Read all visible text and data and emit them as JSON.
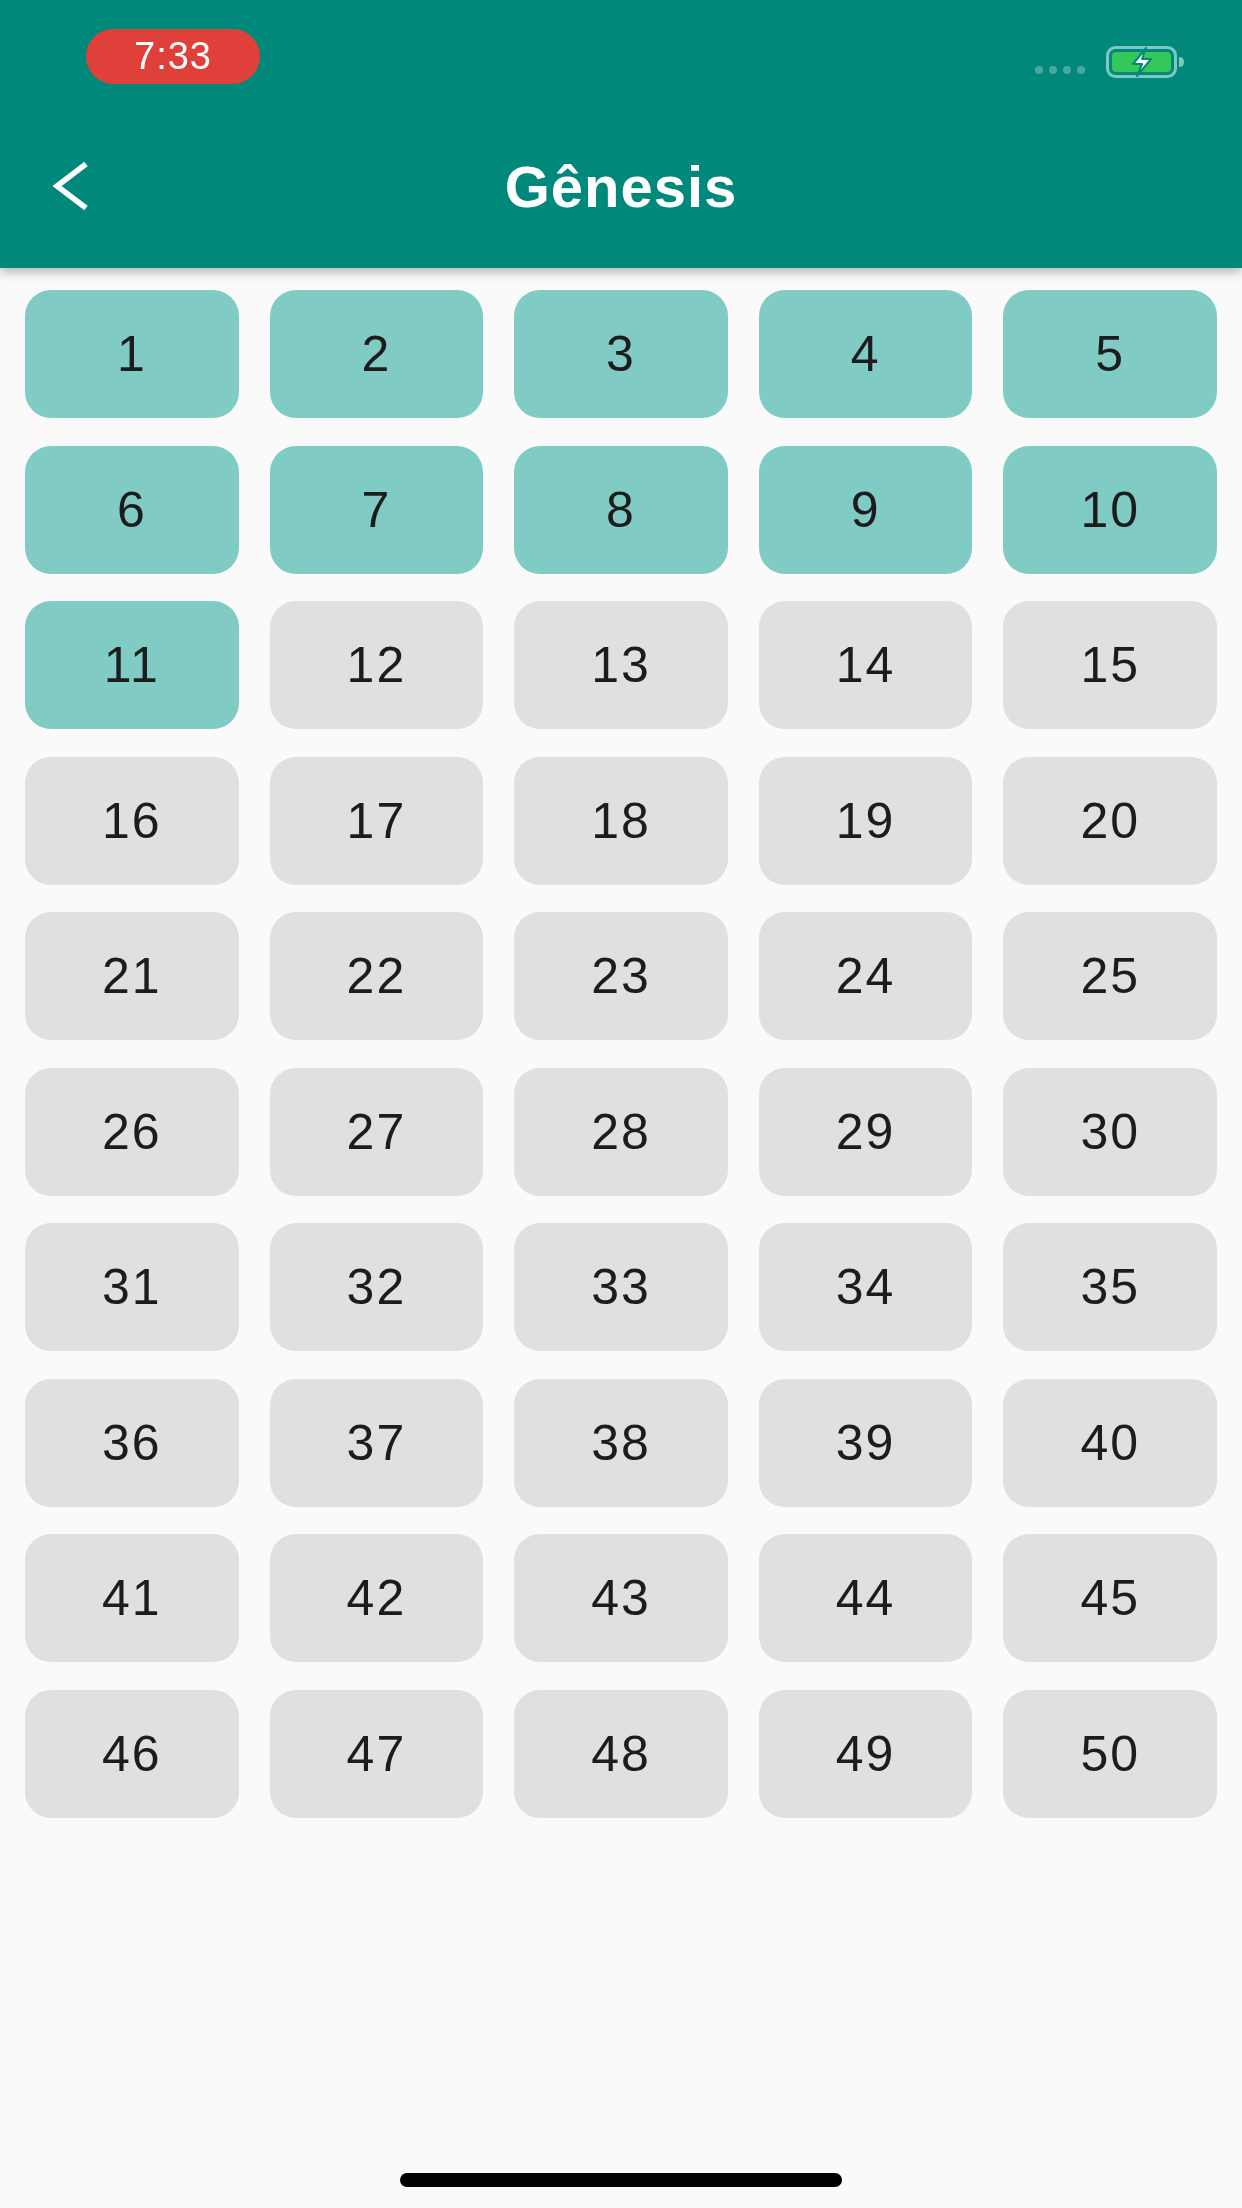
{
  "status_bar": {
    "time": "7:33"
  },
  "header": {
    "title": "Gênesis"
  },
  "chapters": [
    {
      "label": "1",
      "read": true
    },
    {
      "label": "2",
      "read": true
    },
    {
      "label": "3",
      "read": true
    },
    {
      "label": "4",
      "read": true
    },
    {
      "label": "5",
      "read": true
    },
    {
      "label": "6",
      "read": true
    },
    {
      "label": "7",
      "read": true
    },
    {
      "label": "8",
      "read": true
    },
    {
      "label": "9",
      "read": true
    },
    {
      "label": "10",
      "read": true
    },
    {
      "label": "11",
      "read": true
    },
    {
      "label": "12",
      "read": false
    },
    {
      "label": "13",
      "read": false
    },
    {
      "label": "14",
      "read": false
    },
    {
      "label": "15",
      "read": false
    },
    {
      "label": "16",
      "read": false
    },
    {
      "label": "17",
      "read": false
    },
    {
      "label": "18",
      "read": false
    },
    {
      "label": "19",
      "read": false
    },
    {
      "label": "20",
      "read": false
    },
    {
      "label": "21",
      "read": false
    },
    {
      "label": "22",
      "read": false
    },
    {
      "label": "23",
      "read": false
    },
    {
      "label": "24",
      "read": false
    },
    {
      "label": "25",
      "read": false
    },
    {
      "label": "26",
      "read": false
    },
    {
      "label": "27",
      "read": false
    },
    {
      "label": "28",
      "read": false
    },
    {
      "label": "29",
      "read": false
    },
    {
      "label": "30",
      "read": false
    },
    {
      "label": "31",
      "read": false
    },
    {
      "label": "32",
      "read": false
    },
    {
      "label": "33",
      "read": false
    },
    {
      "label": "34",
      "read": false
    },
    {
      "label": "35",
      "read": false
    },
    {
      "label": "36",
      "read": false
    },
    {
      "label": "37",
      "read": false
    },
    {
      "label": "38",
      "read": false
    },
    {
      "label": "39",
      "read": false
    },
    {
      "label": "40",
      "read": false
    },
    {
      "label": "41",
      "read": false
    },
    {
      "label": "42",
      "read": false
    },
    {
      "label": "43",
      "read": false
    },
    {
      "label": "44",
      "read": false
    },
    {
      "label": "45",
      "read": false
    },
    {
      "label": "46",
      "read": false
    },
    {
      "label": "47",
      "read": false
    },
    {
      "label": "48",
      "read": false
    },
    {
      "label": "49",
      "read": false
    },
    {
      "label": "50",
      "read": false
    }
  ]
}
